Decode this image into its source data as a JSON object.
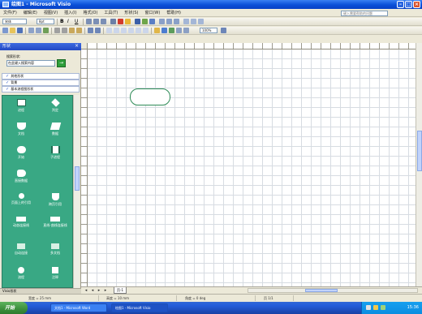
{
  "window": {
    "title": "绘图1 - Microsoft Visio"
  },
  "menu": [
    "文件(F)",
    "编辑(E)",
    "视图(V)",
    "插入(I)",
    "格式(O)",
    "工具(T)",
    "形状(S)",
    "窗口(W)",
    "帮助(H)"
  ],
  "help_box": {
    "placeholder": "键入需要帮助的问题"
  },
  "toolbar": {
    "font_name": "宋体",
    "font_size": "8pt",
    "zoom": "100%"
  },
  "shapes_panel": {
    "title": "形状",
    "search_label": "搜索形状:",
    "search_placeholder": "在此键入搜索内容",
    "stencils": [
      "其他形状",
      "背景",
      "基本流程图形状"
    ],
    "shapes": [
      {
        "label": "进程",
        "color": "#FFFFFF"
      },
      {
        "label": "判定",
        "color": "#FFFFFF"
      },
      {
        "label": "文档",
        "color": "#FFFFFF"
      },
      {
        "label": "数据",
        "color": "#FFFFFF"
      },
      {
        "label": "开始",
        "color": "#FFFFFF"
      },
      {
        "label": "子进程",
        "color": "#FFFFFF"
      },
      {
        "label": "直接数据",
        "color": "#FFFFFF"
      },
      {
        "label": "",
        "color": "#FFFFFF"
      },
      {
        "label": "页面上的引用",
        "color": "#FFFFFF"
      },
      {
        "label": "跨页引用",
        "color": "#FFFFFF"
      },
      {
        "label": "动态连接线",
        "color": "#FFFFFF"
      },
      {
        "label": "直线-曲线连接线",
        "color": "#FFFFFF"
      },
      {
        "label": "自动连接",
        "color": "#FFFFFF"
      },
      {
        "label": "多文档",
        "color": "#FFFFFF"
      },
      {
        "label": "流程",
        "color": "#FFFFFF"
      },
      {
        "label": "注释",
        "color": "#FFFFFF"
      }
    ],
    "footer": "Visio形状"
  },
  "page_tabs": {
    "current": "页-1"
  },
  "status": {
    "width": "宽度 = 25 mm",
    "height": "高度 = 10 mm",
    "angle": "角度 = 0 deg",
    "page": "页 1/1"
  },
  "taskbar": {
    "start": "开始",
    "items": [
      "文档1 - Microsoft Word",
      "绘图1 - Microsoft Visio"
    ],
    "time": "15:36"
  },
  "colors": {
    "title_blue": "#0A4FD8",
    "stencil_green": "#39A884",
    "canvas_shape_border": "#2E8B57",
    "start_green": "#3C8F3C"
  }
}
